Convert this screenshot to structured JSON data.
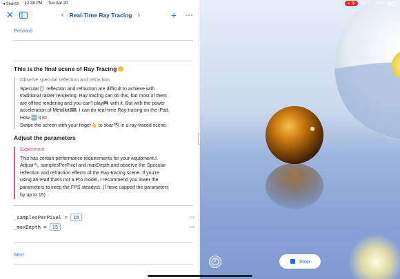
{
  "statusbar": {
    "back": "◂ Search",
    "time": "12:38 PM",
    "date": "Tue Apr 20",
    "battery": "60%"
  },
  "toolbar": {
    "title": "Real-Time Ray Tracing"
  },
  "nav": {
    "previous": "Previous",
    "next": "Next"
  },
  "content": {
    "heading1": "This is the final scene of Ray Tracing",
    "observe_title": "Observe specular reflection and refraction",
    "observe_line1": "Specular",
    "observe_line1b": " reflection and refraction are difficult to achieve with",
    "observe_line2": "traditional raster rendering. Ray tracing can do this, but most of them",
    "observe_line3": "are offline rendering and you can't play",
    "observe_line3b": " with it. But with the power",
    "observe_line4": "acceleration of Metalkit",
    "observe_line4b": ", I can do real-time Ray-tracing on the iPad.",
    "observe_line5": "How",
    "observe_line5b": " it is!",
    "observe_line6": " Swipe the screen with your finger",
    "observe_line6b": " to soar",
    "observe_line6c": " in a ray-traced scene.",
    "heading2": "Adjust the parameters",
    "exp_title": "Experiment",
    "exp_line1": "This has certain performance requirements for your equipment",
    "exp_line2": "Adjust",
    "exp_line2b": " samplesPerPixel and maxDepth and observe the Specular",
    "exp_line3": "reflection and refraction effects of the Ray-tracing scene. If you're",
    "exp_line4": "using an iPad that's not a Pro model, I recommend you lower the",
    "exp_line5": "parameters to keep the FPS steady",
    "exp_line5b": ". (I have capped the parameters",
    "exp_line6": "by up to 15)"
  },
  "code": {
    "line1_label": "_samplesPerPixel = ",
    "line1_value": "16",
    "line2_label": "_maxDepth = ",
    "line2_value": "15",
    "tag": "123"
  },
  "render": {
    "stop_label": "Stop"
  },
  "colors": {
    "accent": "#1a73e8",
    "recording": "#d93025",
    "experiment": "#e04f9a"
  }
}
